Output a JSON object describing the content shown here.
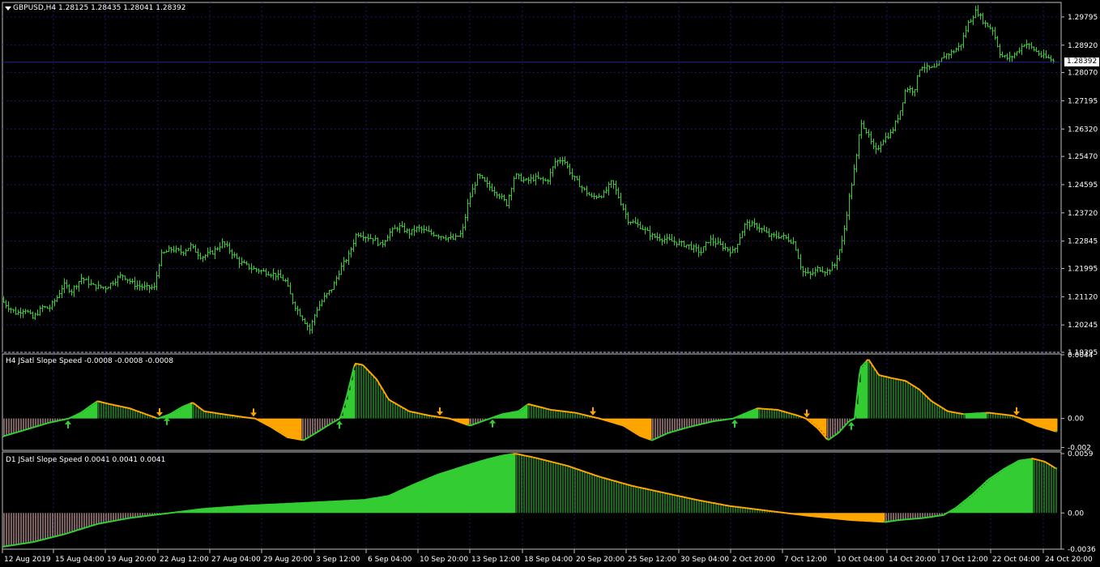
{
  "symbol_header": "GBPUSD,H4  1.28125 1.28435 1.28041 1.28392",
  "current_price": "1.28392",
  "colors": {
    "background": "#000000",
    "candle": "#33cc33",
    "grid": "#1a1a66",
    "bull": "#33cc33",
    "bear": "#ffa500",
    "price_line": "#1c2a8c",
    "axis_text": "#ffffff",
    "pink": "#f8c0c0"
  },
  "main_axis_labels": [
    "1.29795",
    "1.28920",
    "1.28070",
    "1.27195",
    "1.26320",
    "1.25470",
    "1.24595",
    "1.23720",
    "1.22845",
    "1.21995",
    "1.21120",
    "1.20245",
    "1.19395"
  ],
  "time_axis_labels": [
    "12 Aug 2019",
    "15 Aug 04:00",
    "19 Aug 20:00",
    "22 Aug 12:00",
    "27 Aug 04:00",
    "29 Aug 20:00",
    "3 Sep 12:00",
    "6 Sep 04:00",
    "10 Sep 20:00",
    "13 Sep 12:00",
    "18 Sep 04:00",
    "20 Sep 20:00",
    "25 Sep 12:00",
    "30 Sep 04:00",
    "2 Oct 20:00",
    "7 Oct 12:00",
    "10 Oct 04:00",
    "14 Oct 20:00",
    "17 Oct 12:00",
    "22 Oct 04:00",
    "24 Oct 20:00"
  ],
  "indicator_h4": {
    "title": "H4 JSatl Slope Speed -0.0008 -0.0008 -0.0008",
    "axis_labels": [
      "0.0044",
      "0.00",
      "-0.002"
    ]
  },
  "indicator_d1": {
    "title": "D1 JSatl Slope Speed 0.0041 0.0041 0.0041",
    "axis_labels": [
      "0.0059",
      "0.00",
      "-0.0036"
    ]
  },
  "chart_data": [
    {
      "type": "candlestick",
      "title": "GBPUSD,H4",
      "ylim": [
        1.19395,
        1.30245
      ],
      "x_range": [
        "12 Aug 2019",
        "24 Oct 20:00"
      ],
      "close_path": [
        [
          0,
          1.2105
        ],
        [
          10,
          1.208
        ],
        [
          20,
          1.206
        ],
        [
          30,
          1.2075
        ],
        [
          40,
          1.2045
        ],
        [
          52,
          1.208
        ],
        [
          60,
          1.2075
        ],
        [
          70,
          1.211
        ],
        [
          78,
          1.215
        ],
        [
          88,
          1.213
        ],
        [
          100,
          1.217
        ],
        [
          115,
          1.2145
        ],
        [
          130,
          1.214
        ],
        [
          150,
          1.218
        ],
        [
          165,
          1.215
        ],
        [
          180,
          1.214
        ],
        [
          190,
          1.214
        ],
        [
          198,
          1.224
        ],
        [
          210,
          1.226
        ],
        [
          225,
          1.225
        ],
        [
          235,
          1.227
        ],
        [
          248,
          1.2235
        ],
        [
          262,
          1.225
        ],
        [
          275,
          1.228
        ],
        [
          285,
          1.225
        ],
        [
          295,
          1.222
        ],
        [
          310,
          1.22
        ],
        [
          325,
          1.219
        ],
        [
          340,
          1.218
        ],
        [
          352,
          1.216
        ],
        [
          362,
          1.209
        ],
        [
          372,
          1.205
        ],
        [
          382,
          1.201
        ],
        [
          390,
          1.207
        ],
        [
          400,
          1.211
        ],
        [
          410,
          1.214
        ],
        [
          420,
          1.22
        ],
        [
          430,
          1.224
        ],
        [
          440,
          1.231
        ],
        [
          450,
          1.23
        ],
        [
          462,
          1.229
        ],
        [
          470,
          1.227
        ],
        [
          480,
          1.231
        ],
        [
          492,
          1.233
        ],
        [
          505,
          1.231
        ],
        [
          515,
          1.2325
        ],
        [
          530,
          1.231
        ],
        [
          545,
          1.23
        ],
        [
          560,
          1.229
        ],
        [
          570,
          1.231
        ],
        [
          578,
          1.241
        ],
        [
          590,
          1.249
        ],
        [
          600,
          1.246
        ],
        [
          615,
          1.243
        ],
        [
          625,
          1.24
        ],
        [
          635,
          1.249
        ],
        [
          648,
          1.247
        ],
        [
          660,
          1.248
        ],
        [
          675,
          1.247
        ],
        [
          685,
          1.253
        ],
        [
          695,
          1.254
        ],
        [
          705,
          1.249
        ],
        [
          718,
          1.245
        ],
        [
          730,
          1.242
        ],
        [
          745,
          1.243
        ],
        [
          755,
          1.247
        ],
        [
          765,
          1.241
        ],
        [
          775,
          1.235
        ],
        [
          790,
          1.233
        ],
        [
          805,
          1.23
        ],
        [
          820,
          1.229
        ],
        [
          835,
          1.228
        ],
        [
          850,
          1.227
        ],
        [
          865,
          1.225
        ],
        [
          875,
          1.229
        ],
        [
          890,
          1.227
        ],
        [
          905,
          1.225
        ],
        [
          920,
          1.234
        ],
        [
          935,
          1.233
        ],
        [
          950,
          1.23
        ],
        [
          965,
          1.23
        ],
        [
          980,
          1.228
        ],
        [
          990,
          1.219
        ],
        [
          1000,
          1.218
        ],
        [
          1010,
          1.22
        ],
        [
          1020,
          1.219
        ],
        [
          1030,
          1.221
        ],
        [
          1040,
          1.229
        ],
        [
          1048,
          1.242
        ],
        [
          1058,
          1.256
        ],
        [
          1062,
          1.266
        ],
        [
          1070,
          1.262
        ],
        [
          1080,
          1.256
        ],
        [
          1090,
          1.26
        ],
        [
          1100,
          1.262
        ],
        [
          1110,
          1.268
        ],
        [
          1118,
          1.276
        ],
        [
          1128,
          1.275
        ],
        [
          1136,
          1.283
        ],
        [
          1145,
          1.282
        ],
        [
          1155,
          1.282
        ],
        [
          1165,
          1.286
        ],
        [
          1175,
          1.287
        ],
        [
          1185,
          1.289
        ],
        [
          1195,
          1.296
        ],
        [
          1205,
          1.3
        ],
        [
          1215,
          1.296
        ],
        [
          1225,
          1.294
        ],
        [
          1235,
          1.286
        ],
        [
          1245,
          1.285
        ],
        [
          1255,
          1.287
        ],
        [
          1265,
          1.29
        ],
        [
          1275,
          1.288
        ],
        [
          1285,
          1.286
        ],
        [
          1295,
          1.285
        ],
        [
          1302,
          1.284
        ]
      ]
    },
    {
      "type": "area",
      "title": "H4 JSatl Slope Speed",
      "ylim": [
        -0.0022,
        0.0044
      ],
      "series_path": [
        [
          0,
          -0.0013
        ],
        [
          30,
          -0.0008
        ],
        [
          60,
          -0.0003
        ],
        [
          85,
          0.0
        ],
        [
          100,
          0.0004
        ],
        [
          120,
          0.0012
        ],
        [
          135,
          0.001
        ],
        [
          160,
          0.0007
        ],
        [
          195,
          0.0
        ],
        [
          210,
          0.0003
        ],
        [
          225,
          0.0008
        ],
        [
          238,
          0.0011
        ],
        [
          252,
          0.0005
        ],
        [
          275,
          0.0003
        ],
        [
          300,
          0.0001
        ],
        [
          315,
          0.0
        ],
        [
          335,
          -0.0006
        ],
        [
          355,
          -0.0013
        ],
        [
          375,
          -0.0015
        ],
        [
          390,
          -0.001
        ],
        [
          410,
          -0.0003
        ],
        [
          420,
          0.0
        ],
        [
          428,
          0.0015
        ],
        [
          438,
          0.0038
        ],
        [
          448,
          0.0037
        ],
        [
          465,
          0.0027
        ],
        [
          480,
          0.0013
        ],
        [
          505,
          0.0005
        ],
        [
          530,
          0.0002
        ],
        [
          555,
          0.0
        ],
        [
          580,
          -0.0005
        ],
        [
          605,
          0.0
        ],
        [
          620,
          0.0003
        ],
        [
          640,
          0.0005
        ],
        [
          652,
          0.001
        ],
        [
          680,
          0.0006
        ],
        [
          710,
          0.0004
        ],
        [
          740,
          0.0
        ],
        [
          770,
          -0.0005
        ],
        [
          790,
          -0.0012
        ],
        [
          805,
          -0.0015
        ],
        [
          825,
          -0.001
        ],
        [
          850,
          -0.0006
        ],
        [
          880,
          -0.0002
        ],
        [
          905,
          0.0
        ],
        [
          935,
          0.0007
        ],
        [
          960,
          0.0006
        ],
        [
          985,
          0.0002
        ],
        [
          995,
          0.0
        ],
        [
          1010,
          -0.0007
        ],
        [
          1022,
          -0.0015
        ],
        [
          1035,
          -0.001
        ],
        [
          1048,
          -0.0002
        ],
        [
          1055,
          0.0
        ],
        [
          1062,
          0.0035
        ],
        [
          1072,
          0.0041
        ],
        [
          1085,
          0.003
        ],
        [
          1100,
          0.0028
        ],
        [
          1118,
          0.0026
        ],
        [
          1135,
          0.002
        ],
        [
          1150,
          0.0012
        ],
        [
          1170,
          0.0005
        ],
        [
          1190,
          0.0003
        ],
        [
          1220,
          0.0004
        ],
        [
          1250,
          0.0002
        ],
        [
          1260,
          0.0
        ],
        [
          1280,
          -0.0005
        ],
        [
          1304,
          -0.0009
        ]
      ],
      "arrows_up": [
        84,
        206,
        419,
        608,
        907,
        1051
      ],
      "arrows_down": [
        197,
        313,
        543,
        732,
        996,
        1255
      ]
    },
    {
      "type": "area",
      "title": "D1 JSatl Slope Speed",
      "ylim": [
        -0.0036,
        0.0059
      ],
      "series_path": [
        [
          0,
          -0.0034
        ],
        [
          40,
          -0.0029
        ],
        [
          80,
          -0.0021
        ],
        [
          120,
          -0.0011
        ],
        [
          160,
          -0.0005
        ],
        [
          200,
          -0.0001
        ],
        [
          250,
          0.0004
        ],
        [
          300,
          0.0007
        ],
        [
          350,
          0.0009
        ],
        [
          400,
          0.0011
        ],
        [
          450,
          0.0013
        ],
        [
          480,
          0.0017
        ],
        [
          510,
          0.0028
        ],
        [
          540,
          0.0038
        ],
        [
          575,
          0.0047
        ],
        [
          600,
          0.0053
        ],
        [
          620,
          0.0057
        ],
        [
          636,
          0.0059
        ],
        [
          660,
          0.0055
        ],
        [
          700,
          0.0047
        ],
        [
          740,
          0.0036
        ],
        [
          780,
          0.0027
        ],
        [
          820,
          0.002
        ],
        [
          860,
          0.0013
        ],
        [
          900,
          0.0007
        ],
        [
          950,
          0.0002
        ],
        [
          1000,
          -0.0003
        ],
        [
          1050,
          -0.0007
        ],
        [
          1093,
          -0.0009
        ],
        [
          1110,
          -0.0007
        ],
        [
          1140,
          -0.0005
        ],
        [
          1165,
          -0.0002
        ],
        [
          1180,
          0.0005
        ],
        [
          1200,
          0.0018
        ],
        [
          1220,
          0.0033
        ],
        [
          1240,
          0.0044
        ],
        [
          1258,
          0.0052
        ],
        [
          1275,
          0.0054
        ],
        [
          1290,
          0.0051
        ],
        [
          1304,
          0.0044
        ]
      ]
    }
  ]
}
